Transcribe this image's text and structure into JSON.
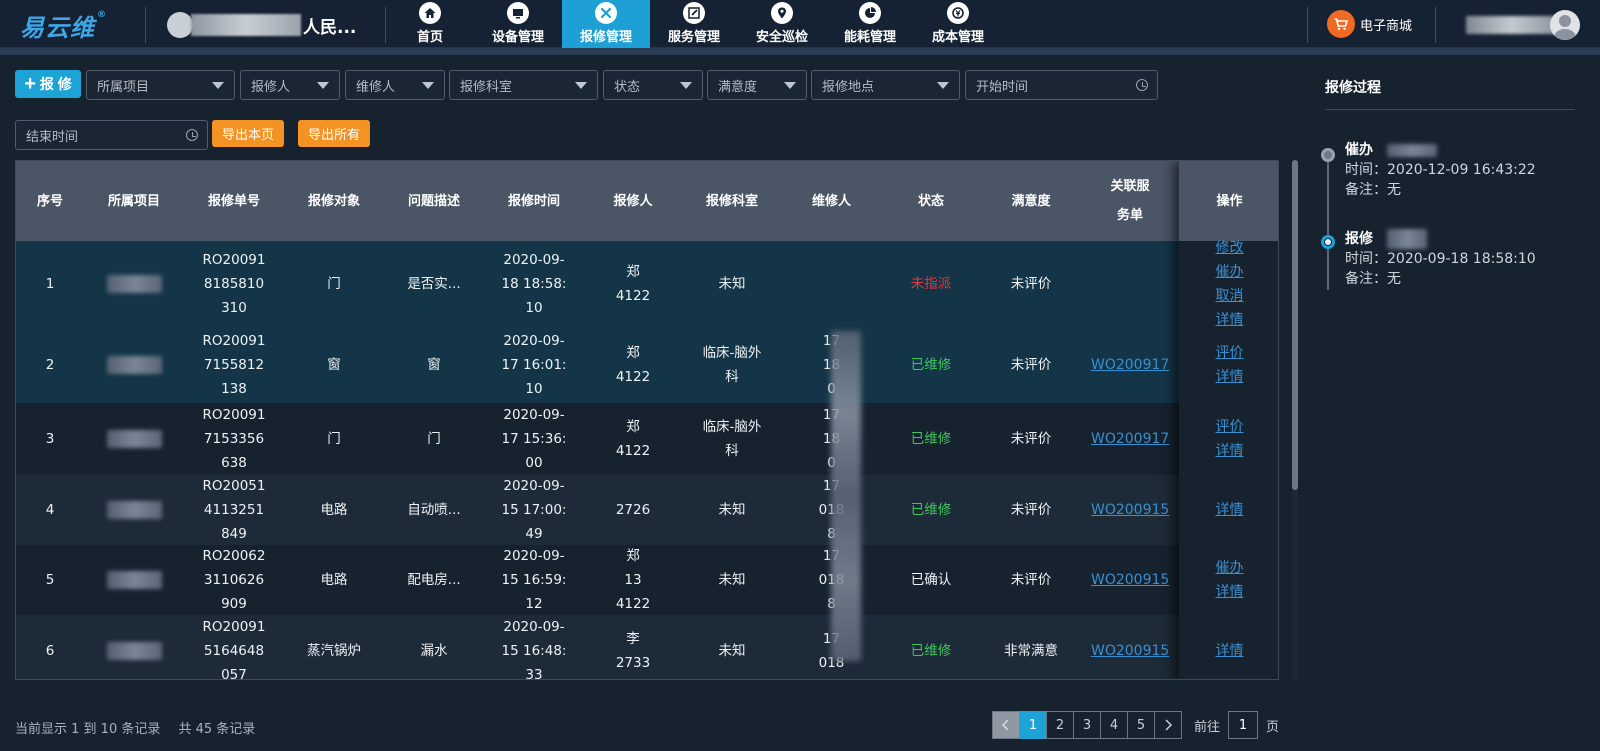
{
  "header": {
    "logo": "易云维",
    "logo_mark": "®",
    "hospital_name": "人民...",
    "nav": [
      {
        "label": "首页",
        "icon": "home-icon"
      },
      {
        "label": "设备管理",
        "icon": "monitor-icon"
      },
      {
        "label": "报修管理",
        "icon": "tools-icon",
        "active": true
      },
      {
        "label": "服务管理",
        "icon": "edit-icon"
      },
      {
        "label": "安全巡检",
        "icon": "location-icon"
      },
      {
        "label": "能耗管理",
        "icon": "pie-chart-icon"
      },
      {
        "label": "成本管理",
        "icon": "money-icon"
      }
    ],
    "shop_label": "电子商城"
  },
  "filters": {
    "add_label": "报 修",
    "project": "所属项目",
    "reporter": "报修人",
    "repairer": "维修人",
    "department": "报修科室",
    "status": "状态",
    "satisfaction": "满意度",
    "location": "报修地点",
    "start_time": "开始时间",
    "end_time": "结束时间",
    "export_page": "导出本页",
    "export_all": "导出所有"
  },
  "table": {
    "headers": [
      "序号",
      "所属项目",
      "报修单号",
      "报修对象",
      "问题描述",
      "报修时间",
      "报修人",
      "报修科室",
      "维修人",
      "状态",
      "满意度",
      "关联服务单",
      "操作"
    ],
    "rows": [
      {
        "no": "1",
        "project": "",
        "order": "RO200918185810310",
        "object": "门",
        "desc": "是否实...",
        "time": "2020-09-18 18:58:10",
        "reporter": "郑 4122",
        "dept": "未知",
        "repairer": "",
        "status": "未指派",
        "satisfaction": "未评价",
        "service": "",
        "ops": [
          "修改",
          "催办",
          "取消",
          "详情"
        ]
      },
      {
        "no": "2",
        "project": "",
        "order": "RO200917155812138",
        "object": "窗",
        "desc": "窗",
        "time": "2020-09-17 16:01:10",
        "reporter": "郑 4122",
        "dept": "临床-脑外科",
        "repairer": "17 18 0",
        "status": "已维修",
        "satisfaction": "未评价",
        "service": "WO200917",
        "ops": [
          "评价",
          "详情"
        ]
      },
      {
        "no": "3",
        "project": "",
        "order": "RO200917153356638",
        "object": "门",
        "desc": "门",
        "time": "2020-09-17 15:36:00",
        "reporter": "郑 4122",
        "dept": "临床-脑外科",
        "repairer": "17 18 0",
        "status": "已维修",
        "satisfaction": "未评价",
        "service": "WO200917",
        "ops": [
          "评价",
          "详情"
        ]
      },
      {
        "no": "4",
        "project": "",
        "order": "RO200514113251849",
        "object": "电路",
        "desc": "自动喷...",
        "time": "2020-09-15 17:00:49",
        "reporter": "2726",
        "dept": "未知",
        "repairer": "17 018 8",
        "status": "已维修",
        "satisfaction": "未评价",
        "service": "WO200915",
        "ops": [
          "详情"
        ]
      },
      {
        "no": "5",
        "project": "",
        "order": "RO200623110626909",
        "object": "电路",
        "desc": "配电房...",
        "time": "2020-09-15 16:59:12",
        "reporter": "郑 13 4122",
        "dept": "未知",
        "repairer": "17 018 8",
        "status": "已确认",
        "satisfaction": "未评价",
        "service": "WO200915",
        "ops": [
          "催办",
          "详情"
        ]
      },
      {
        "no": "6",
        "project": "",
        "order": "RO200915164648057",
        "object": "蒸汽锅炉",
        "desc": "漏水",
        "time": "2020-09-15 16:48:33",
        "reporter": "李 2733",
        "dept": "未知",
        "repairer": "17 018",
        "status": "已维修",
        "satisfaction": "非常满意",
        "service": "WO200915",
        "ops": [
          "详情"
        ]
      }
    ]
  },
  "footer": {
    "showing": "当前显示 1 到 10 条记录",
    "total": "共 45 条记录",
    "pages": [
      "1",
      "2",
      "3",
      "4",
      "5"
    ],
    "current_page": "1",
    "goto_prefix": "前往",
    "goto_value": "1",
    "goto_suffix": "页"
  },
  "side": {
    "title": "报修过程",
    "timeline": [
      {
        "title": "催办",
        "time": "时间：2020-12-09 16:43:22",
        "note": "备注：无"
      },
      {
        "title": "报修",
        "time": "时间：2020-09-18 18:58:10",
        "note": "备注：无"
      }
    ]
  },
  "colors": {
    "accent": "#1ea3d6",
    "orange": "#f39323",
    "red": "#e03a3a",
    "green": "#3ec55c",
    "link": "#3a8fd0"
  }
}
